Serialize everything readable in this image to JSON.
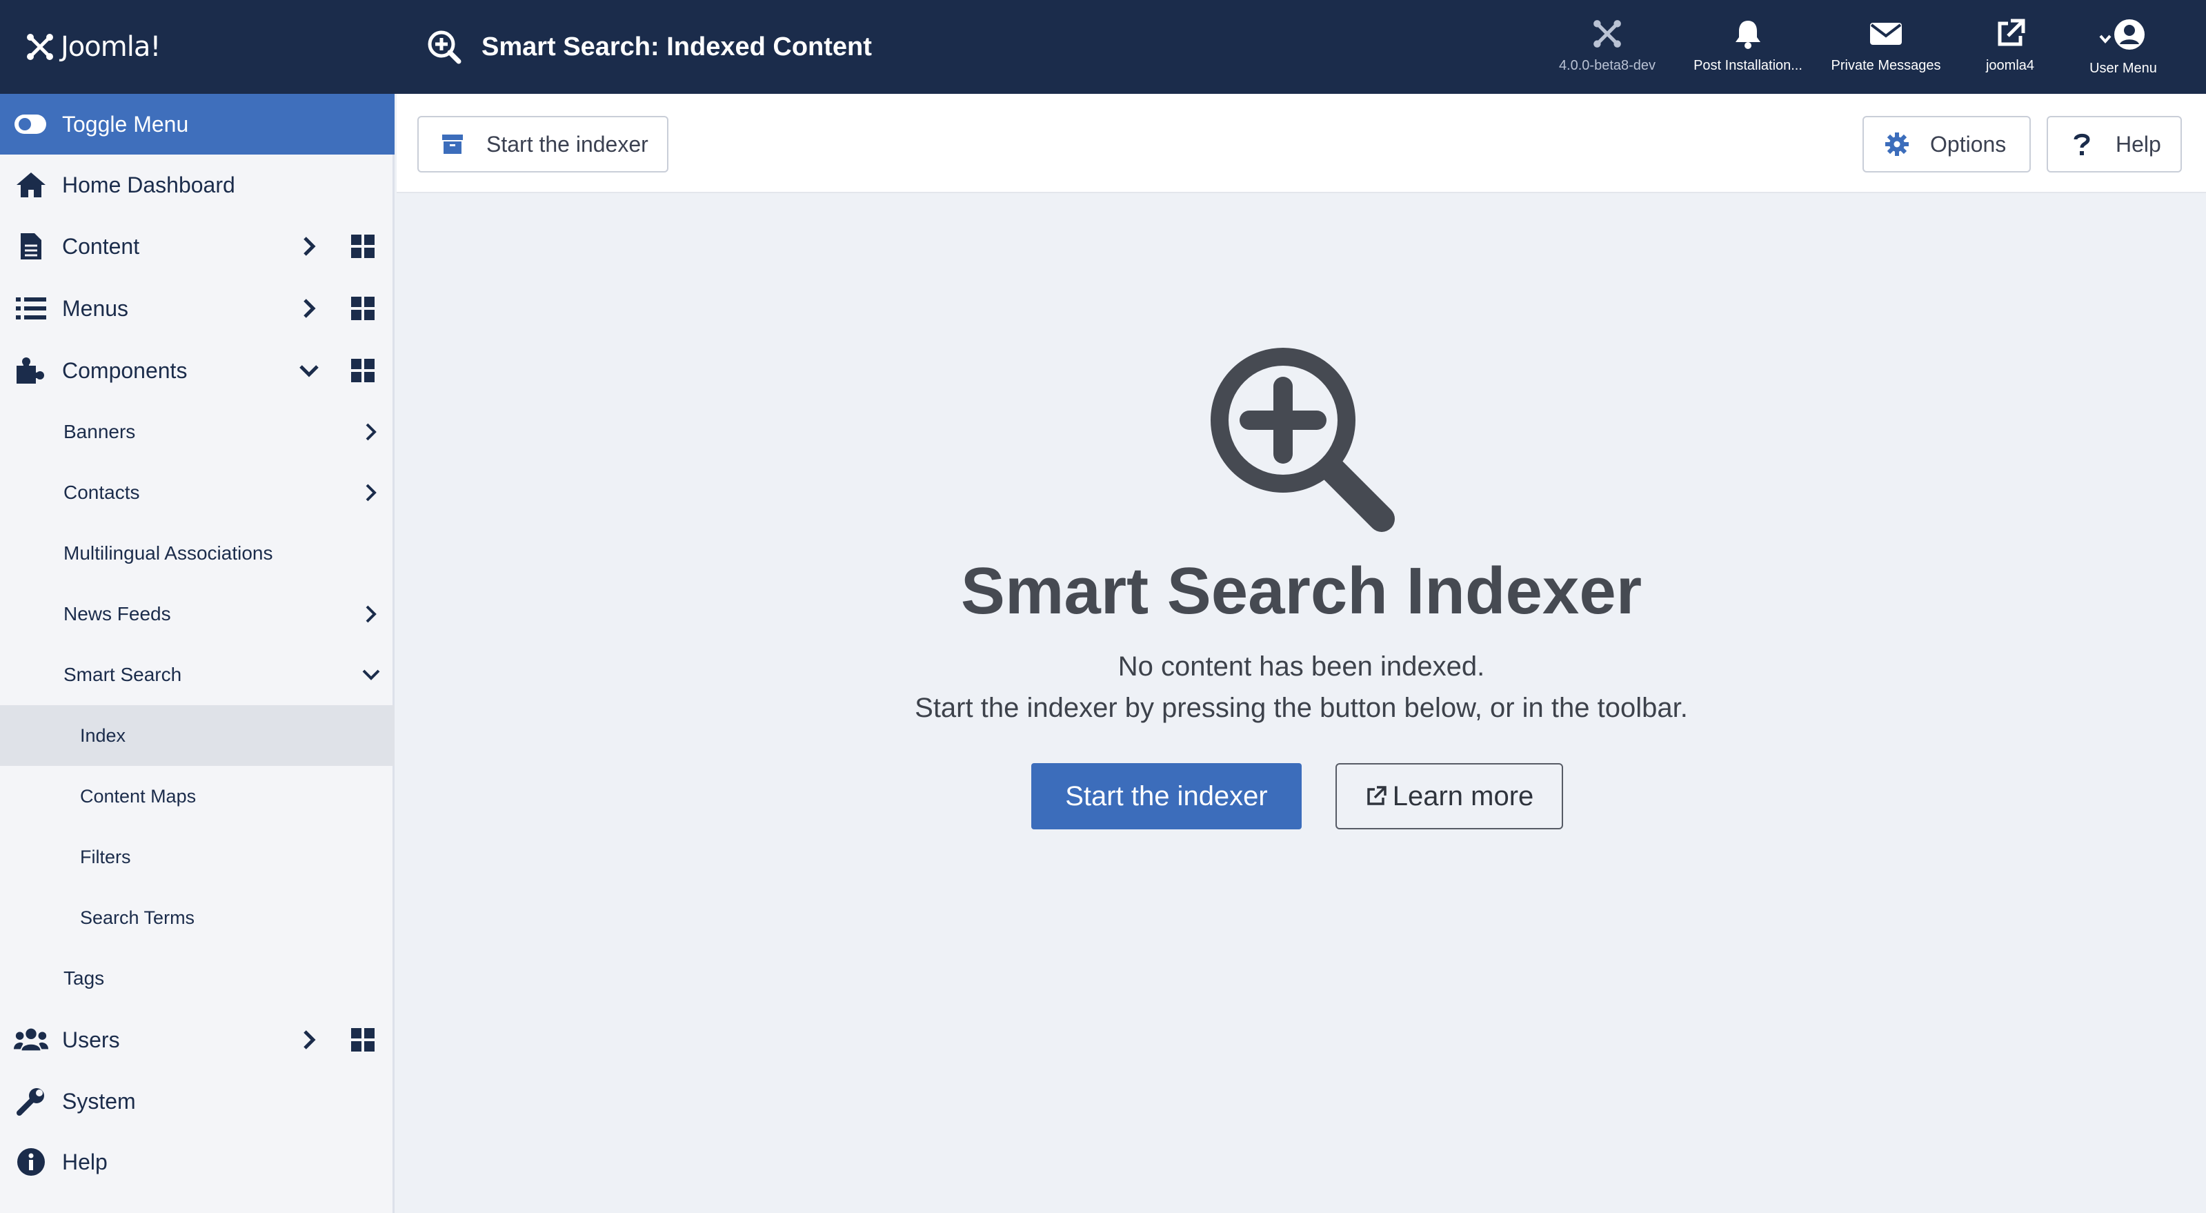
{
  "header": {
    "brand": "Joomla!",
    "page_title": "Smart Search: Indexed Content",
    "items": [
      {
        "label": "4.0.0-beta8-dev",
        "icon": "joomla-icon"
      },
      {
        "label": "Post Installation...",
        "icon": "bell-icon"
      },
      {
        "label": "Private Messages",
        "icon": "envelope-icon"
      },
      {
        "label": "joomla4",
        "icon": "external-link-icon"
      },
      {
        "label": "User Menu",
        "icon": "user-circle-icon"
      }
    ]
  },
  "sidebar": {
    "toggle_label": "Toggle Menu",
    "items": [
      {
        "label": "Home Dashboard",
        "icon": "home-icon"
      },
      {
        "label": "Content",
        "icon": "file-icon"
      },
      {
        "label": "Menus",
        "icon": "list-icon"
      },
      {
        "label": "Components",
        "icon": "puzzle-icon"
      },
      {
        "label": "Banners"
      },
      {
        "label": "Contacts"
      },
      {
        "label": "Multilingual Associations"
      },
      {
        "label": "News Feeds"
      },
      {
        "label": "Smart Search"
      },
      {
        "label": "Index"
      },
      {
        "label": "Content Maps"
      },
      {
        "label": "Filters"
      },
      {
        "label": "Search Terms"
      },
      {
        "label": "Tags"
      },
      {
        "label": "Users",
        "icon": "users-icon"
      },
      {
        "label": "System",
        "icon": "wrench-icon"
      },
      {
        "label": "Help",
        "icon": "info-icon"
      }
    ]
  },
  "toolbar": {
    "start_indexer_label": "Start the indexer",
    "options_label": "Options",
    "help_label": "Help"
  },
  "main": {
    "title": "Smart Search Indexer",
    "line1": "No content has been indexed.",
    "line2": "Start the indexer by pressing the button below, or in the toolbar.",
    "primary_button": "Start the indexer",
    "secondary_button": "Learn more"
  },
  "colors": {
    "header_bg": "#1b2c4b",
    "accent": "#3c6dbb",
    "sidebar_bg": "#f4f5f8",
    "main_bg": "#eef1f6"
  }
}
